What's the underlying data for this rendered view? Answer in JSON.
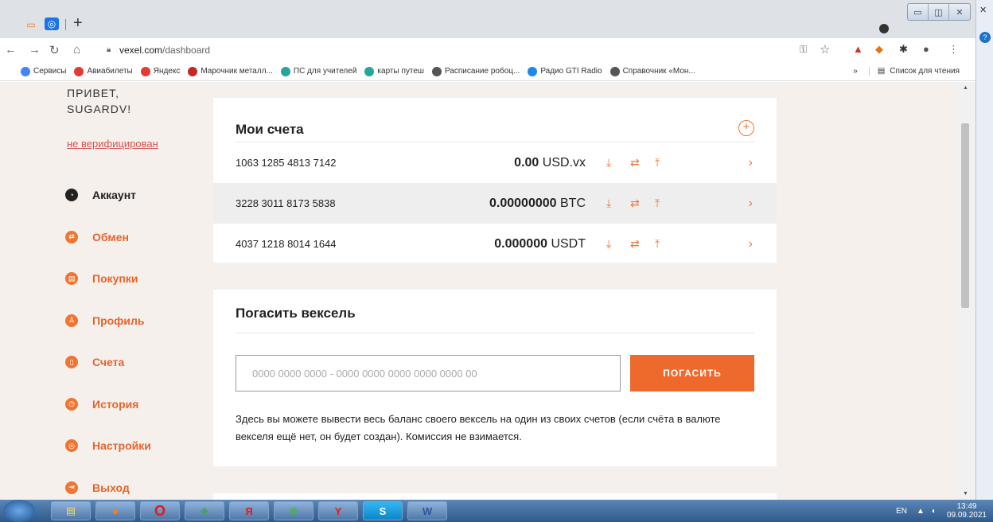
{
  "browser": {
    "url_host": "vexel.com",
    "url_path": "/dashboard",
    "bookmarks": [
      {
        "label": "Сервисы",
        "color": "#4285f4"
      },
      {
        "label": "Авиабилеты",
        "color": "#e53935"
      },
      {
        "label": "Яндекс",
        "color": "#e53935"
      },
      {
        "label": "Марочник металл...",
        "color": "#c62828"
      },
      {
        "label": "ПС для учителей",
        "color": "#26a69a"
      },
      {
        "label": "карты путеш",
        "color": "#26a69a"
      },
      {
        "label": "Расписание робоц...",
        "color": "#555555"
      },
      {
        "label": "Радио GTI Radio",
        "color": "#1e88e5"
      },
      {
        "label": "Справочник «Мон...",
        "color": "#555555"
      }
    ],
    "bookmarks_more": "»",
    "reading_list": "Список для чтения"
  },
  "sidebar": {
    "greeting_line1": "ПРИВЕТ,",
    "greeting_line2": "SUGARDV!",
    "verification": "не верифицирован",
    "items": [
      {
        "label": "Аккаунт",
        "icon": "dashboard-icon"
      },
      {
        "label": "Обмен",
        "icon": "exchange-icon"
      },
      {
        "label": "Покупки",
        "icon": "purchases-icon"
      },
      {
        "label": "Профиль",
        "icon": "profile-icon"
      },
      {
        "label": "Счета",
        "icon": "accounts-icon"
      },
      {
        "label": "История",
        "icon": "history-icon"
      },
      {
        "label": "Настройки",
        "icon": "settings-icon"
      },
      {
        "label": "Выход",
        "icon": "logout-icon"
      }
    ]
  },
  "accounts": {
    "title": "Мои счета",
    "rows": [
      {
        "number": "1063 1285 4813 7142",
        "amount": "0.00",
        "currency": "USD.vx"
      },
      {
        "number": "3228 3011 8173 5838",
        "amount": "0.00000000",
        "currency": "BTC"
      },
      {
        "number": "4037 1218 8014 1644",
        "amount": "0.000000",
        "currency": "USDT"
      }
    ]
  },
  "redeem": {
    "title": "Погасить вексель",
    "placeholder": "0000 0000 0000 - 0000 0000 0000 0000 0000 00",
    "button": "ПОГАСИТЬ",
    "note": "Здесь вы можете вывести весь баланс своего вексель на один из своих счетов (если счёта в валюте векселя ещё нет, он будет создан). Комиссия не взимается."
  },
  "taskbar": {
    "lang": "EN",
    "time": "13:49",
    "date": "09.09.2021"
  },
  "colors": {
    "accent": "#f07533",
    "page_bg": "#f5f0ec"
  }
}
